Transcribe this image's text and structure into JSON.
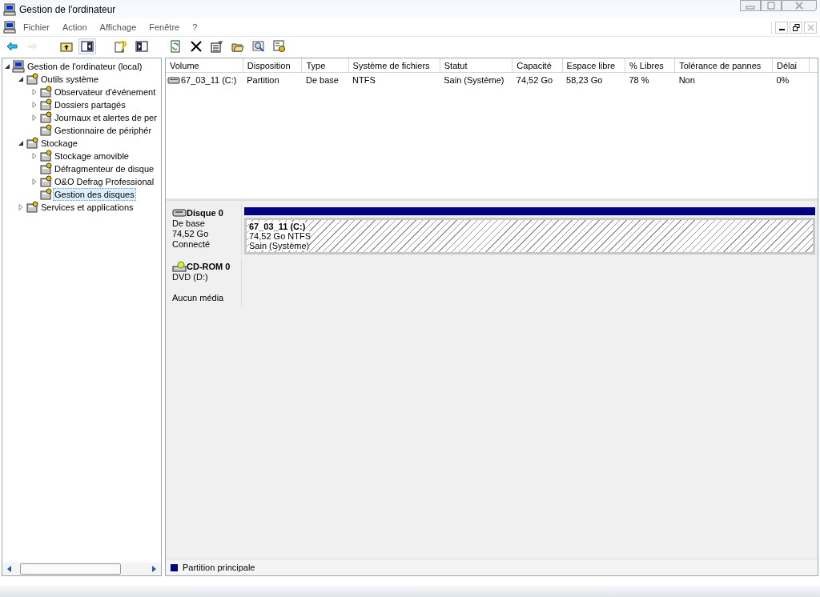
{
  "window": {
    "title": "Gestion de l'ordinateur"
  },
  "menu": [
    "Fichier",
    "Action",
    "Affichage",
    "Fenêtre",
    "?"
  ],
  "toolbar": [
    {
      "kind": "back",
      "disabled": false,
      "selected": false
    },
    {
      "kind": "forward",
      "disabled": true,
      "selected": false
    },
    {
      "kind": "up",
      "disabled": false,
      "selected": false
    },
    {
      "kind": "tree",
      "disabled": false,
      "selected": true
    },
    {
      "kind": "help",
      "disabled": false,
      "selected": false
    },
    {
      "kind": "action",
      "disabled": false,
      "selected": false
    },
    {
      "kind": "refresh",
      "disabled": false,
      "selected": false
    },
    {
      "kind": "delete",
      "disabled": false,
      "selected": false
    },
    {
      "kind": "properties",
      "disabled": false,
      "selected": false
    },
    {
      "kind": "open",
      "disabled": false,
      "selected": false
    },
    {
      "kind": "search",
      "disabled": false,
      "selected": false
    },
    {
      "kind": "settings",
      "disabled": false,
      "selected": false
    }
  ],
  "tree": [
    {
      "label": "Gestion de l'ordinateur (local)",
      "expanded": true,
      "selected": false,
      "children": [
        {
          "label": "Outils système",
          "expanded": true,
          "selected": false,
          "children": [
            {
              "label": "Observateur d'événement",
              "expanded": false,
              "selected": false
            },
            {
              "label": "Dossiers partagés",
              "expanded": false,
              "selected": false
            },
            {
              "label": "Journaux et alertes de per",
              "expanded": false,
              "selected": false
            },
            {
              "label": "Gestionnaire de périphér",
              "selected": false
            }
          ]
        },
        {
          "label": "Stockage",
          "expanded": true,
          "selected": false,
          "children": [
            {
              "label": "Stockage amovible",
              "expanded": false,
              "selected": false
            },
            {
              "label": "Défragmenteur de disque",
              "selected": false
            },
            {
              "label": "O&O Defrag Professional",
              "expanded": false,
              "selected": false
            },
            {
              "label": "Gestion des disques",
              "selected": true
            }
          ]
        },
        {
          "label": "Services et applications",
          "expanded": false,
          "selected": false
        }
      ]
    }
  ],
  "volumes": {
    "columns": [
      "Volume",
      "Disposition",
      "Type",
      "Système de fichiers",
      "Statut",
      "Capacité",
      "Espace libre",
      "% Libres",
      "Tolérance de pannes",
      "Délai"
    ],
    "rows": [
      [
        "67_03_11 (C:)",
        "Partition",
        "De base",
        "NTFS",
        "Sain (Système)",
        "74,52 Go",
        "58,23 Go",
        "78 %",
        "Non",
        "0%"
      ]
    ]
  },
  "disks": [
    {
      "kind": "disk",
      "name": "Disque 0",
      "lines": [
        "De base",
        "74,52 Go"
      ],
      "status": "Connecté",
      "partitions": [
        {
          "name": "67_03_11  (C:)",
          "lines": [
            "74,52 Go NTFS",
            "Sain (Système)"
          ],
          "color": "#000080"
        }
      ]
    },
    {
      "kind": "cdrom",
      "name": "CD-ROM 0",
      "lines": [
        "DVD (D:)"
      ],
      "status": "Aucun média"
    }
  ],
  "legend": [
    {
      "label": "Partition principale",
      "color": "#000080"
    }
  ]
}
